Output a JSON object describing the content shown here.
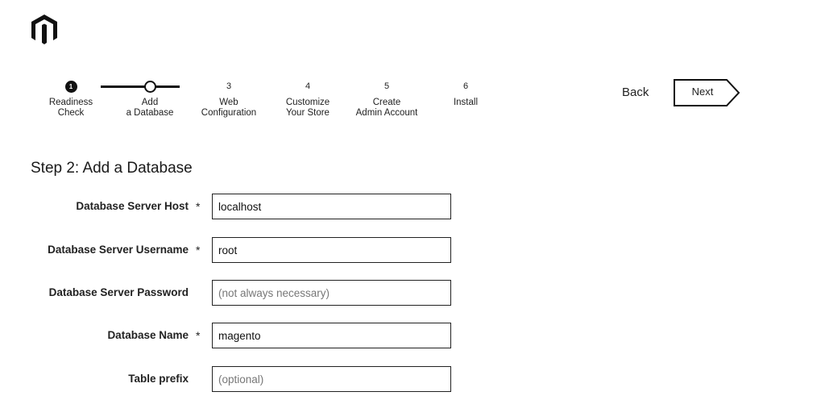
{
  "logo": {
    "icon": "magento-logo-icon"
  },
  "progress": {
    "steps": [
      {
        "marker": "1",
        "label": "Readiness\nCheck",
        "state": "done"
      },
      {
        "marker": "",
        "label": "Add\na Database",
        "state": "current"
      },
      {
        "marker": "3",
        "label": "Web\nConfiguration",
        "state": "todo"
      },
      {
        "marker": "4",
        "label": "Customize\nYour Store",
        "state": "todo"
      },
      {
        "marker": "5",
        "label": "Create\nAdmin Account",
        "state": "todo"
      },
      {
        "marker": "6",
        "label": "Install",
        "state": "todo"
      }
    ]
  },
  "nav": {
    "back_label": "Back",
    "next_label": "Next"
  },
  "page": {
    "title": "Step 2: Add a Database"
  },
  "form": {
    "host": {
      "label": "Database Server Host",
      "required": "*",
      "value": "localhost",
      "placeholder": ""
    },
    "username": {
      "label": "Database Server Username",
      "required": "*",
      "value": "root",
      "placeholder": ""
    },
    "password": {
      "label": "Database Server Password",
      "required": "",
      "value": "",
      "placeholder": "(not always necessary)"
    },
    "dbname": {
      "label": "Database Name",
      "required": "*",
      "value": "magento",
      "placeholder": ""
    },
    "prefix": {
      "label": "Table prefix",
      "required": "",
      "value": "",
      "placeholder": "(optional)"
    }
  }
}
